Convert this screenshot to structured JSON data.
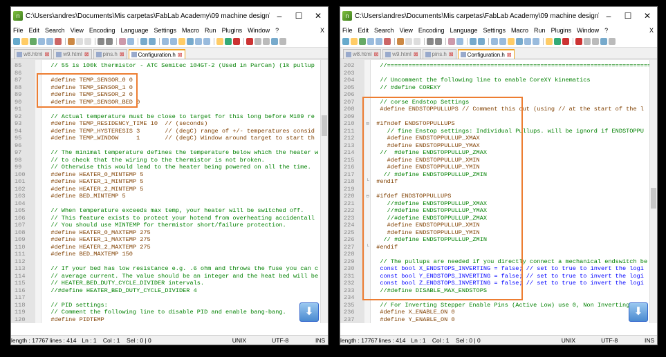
{
  "left": {
    "title": "C:\\Users\\andres\\Documents\\Mis carpetas\\FabLab Academy\\09 machine design\\bib\\Falla3D-m...",
    "menu": [
      "File",
      "Edit",
      "Search",
      "View",
      "Encoding",
      "Language",
      "Settings",
      "Macro",
      "Run",
      "Plugins",
      "Window",
      "?"
    ],
    "menu_close": "X",
    "tabs": [
      {
        "label": "w8.html",
        "active": false
      },
      {
        "label": "w9.html",
        "active": false
      },
      {
        "label": "pins.h",
        "active": false
      },
      {
        "label": "Configuration.h",
        "active": true
      }
    ],
    "lines": [
      {
        "n": "85",
        "t": "  // 55 is 100k thermistor - ATC Semitec 104GT-2 (Used in ParCan) (1k pullup",
        "s": "cm",
        "f": ""
      },
      {
        "n": "86",
        "t": "",
        "s": "",
        "f": ""
      },
      {
        "n": "87",
        "t": "  #define TEMP_SENSOR_0 0",
        "s": "pre",
        "f": ""
      },
      {
        "n": "88",
        "t": "  #define TEMP_SENSOR_1 0",
        "s": "pre",
        "f": ""
      },
      {
        "n": "89",
        "t": "  #define TEMP_SENSOR_2 0",
        "s": "pre",
        "f": ""
      },
      {
        "n": "90",
        "t": "  #define TEMP_SENSOR_BED 0",
        "s": "pre",
        "f": ""
      },
      {
        "n": "91",
        "t": "",
        "s": "",
        "f": ""
      },
      {
        "n": "92",
        "t": "  // Actual temperature must be close to target for this long before M109 re",
        "s": "cm",
        "f": ""
      },
      {
        "n": "93",
        "t": "  #define TEMP_RESIDENCY_TIME 10  // (seconds)",
        "s": "pre",
        "f": ""
      },
      {
        "n": "94",
        "t": "  #define TEMP_HYSTERESIS 3       // (degC) range of +/- temperatures consid",
        "s": "pre",
        "f": ""
      },
      {
        "n": "95",
        "t": "  #define TEMP_WINDOW     1       // (degC) Window around target to start th",
        "s": "pre",
        "f": ""
      },
      {
        "n": "96",
        "t": "",
        "s": "",
        "f": ""
      },
      {
        "n": "97",
        "t": "  // The minimal temperature defines the temperature below which the heater w",
        "s": "cm",
        "f": ""
      },
      {
        "n": "98",
        "t": "  // to check that the wiring to the thermistor is not broken.",
        "s": "cm",
        "f": ""
      },
      {
        "n": "99",
        "t": "  // Otherwise this would lead to the heater being powered on all the time.",
        "s": "cm",
        "f": ""
      },
      {
        "n": "100",
        "t": "  #define HEATER_0_MINTEMP 5",
        "s": "pre",
        "f": ""
      },
      {
        "n": "101",
        "t": "  #define HEATER_1_MINTEMP 5",
        "s": "pre",
        "f": ""
      },
      {
        "n": "102",
        "t": "  #define HEATER_2_MINTEMP 5",
        "s": "pre",
        "f": ""
      },
      {
        "n": "103",
        "t": "  #define BED_MINTEMP 5",
        "s": "pre",
        "f": ""
      },
      {
        "n": "104",
        "t": "",
        "s": "",
        "f": ""
      },
      {
        "n": "105",
        "t": "  // When temperature exceeds max temp, your heater will be switched off.",
        "s": "cm",
        "f": ""
      },
      {
        "n": "106",
        "t": "  // This feature exists to protect your hotend from overheating accidentall",
        "s": "cm",
        "f": ""
      },
      {
        "n": "107",
        "t": "  // You should use MINTEMP for thermistor short/failure protection.",
        "s": "cm",
        "f": ""
      },
      {
        "n": "108",
        "t": "  #define HEATER_0_MAXTEMP 275",
        "s": "pre",
        "f": ""
      },
      {
        "n": "109",
        "t": "  #define HEATER_1_MAXTEMP 275",
        "s": "pre",
        "f": ""
      },
      {
        "n": "110",
        "t": "  #define HEATER_2_MAXTEMP 275",
        "s": "pre",
        "f": ""
      },
      {
        "n": "111",
        "t": "  #define BED_MAXTEMP 150",
        "s": "pre",
        "f": ""
      },
      {
        "n": "112",
        "t": "",
        "s": "",
        "f": ""
      },
      {
        "n": "113",
        "t": "  // If your bed has low resistance e.g. .6 ohm and throws the fuse you can c",
        "s": "cm",
        "f": ""
      },
      {
        "n": "114",
        "t": "  // average current. The value should be an integer and the heat bed will be",
        "s": "cm",
        "f": ""
      },
      {
        "n": "115",
        "t": "  // HEATER_BED_DUTY_CYCLE_DIVIDER intervals.",
        "s": "cm",
        "f": ""
      },
      {
        "n": "116",
        "t": "  //#define HEATER_BED_DUTY_CYCLE_DIVIDER 4",
        "s": "cm",
        "f": ""
      },
      {
        "n": "117",
        "t": "",
        "s": "",
        "f": ""
      },
      {
        "n": "118",
        "t": "  // PID settings:",
        "s": "cm",
        "f": ""
      },
      {
        "n": "119",
        "t": "  // Comment the following line to disable PID and enable bang-bang.",
        "s": "cm",
        "f": ""
      },
      {
        "n": "120",
        "t": "  #define PIDTEMP",
        "s": "pre",
        "f": ""
      }
    ],
    "status": [
      "length : 17767",
      "lines : 414",
      "Ln : 1",
      "Col : 1",
      "Sel : 0 | 0",
      "UNIX",
      "UTF-8",
      "INS"
    ]
  },
  "right": {
    "title": "C:\\Users\\andres\\Documents\\Mis carpetas\\FabLab Academy\\09 machine design\\bib\\Falla3D-m...",
    "menu": [
      "File",
      "Edit",
      "Search",
      "View",
      "Encoding",
      "Language",
      "Settings",
      "Macro",
      "Run",
      "Plugins",
      "Window",
      "?"
    ],
    "menu_close": "X",
    "tabs": [
      {
        "label": "w8.html",
        "active": false
      },
      {
        "label": "w9.html",
        "active": false
      },
      {
        "label": "pins.h",
        "active": false
      },
      {
        "label": "Configuration.h",
        "active": true
      }
    ],
    "lines": [
      {
        "n": "202",
        "t": "  //===========================================================================",
        "s": "cm",
        "f": ""
      },
      {
        "n": "203",
        "t": "",
        "s": "",
        "f": ""
      },
      {
        "n": "204",
        "t": "  // Uncomment the following line to enable CoreXY kinematics",
        "s": "cm",
        "f": ""
      },
      {
        "n": "205",
        "t": "  // #define COREXY",
        "s": "cm",
        "f": ""
      },
      {
        "n": "206",
        "t": "",
        "s": "",
        "f": ""
      },
      {
        "n": "207",
        "t": "  // corse Endstop Settings",
        "s": "cm",
        "f": ""
      },
      {
        "n": "208",
        "t": "  #define ENDSTOPPULLUPS // Comment this out (using // at the start of the l",
        "s": "pre",
        "f": ""
      },
      {
        "n": "209",
        "t": "",
        "s": "",
        "f": ""
      },
      {
        "n": "210",
        "t": " #ifndef ENDSTOPPULLUPS",
        "s": "pre",
        "f": "⊟"
      },
      {
        "n": "211",
        "t": "    // fine Enstop settings: Individual Pullups. will be ignord if ENDSTOPPU",
        "s": "cm",
        "f": ""
      },
      {
        "n": "212",
        "t": "    #define ENDSTOPPULLUP_XMAX",
        "s": "pre",
        "f": ""
      },
      {
        "n": "213",
        "t": "    #define ENDSTOPPULLUP_YMAX",
        "s": "pre",
        "f": ""
      },
      {
        "n": "214",
        "t": "  //  #define ENDSTOPPULLUP_ZMAX",
        "s": "cm",
        "f": ""
      },
      {
        "n": "215",
        "t": "    #define ENDSTOPPULLUP_XMIN",
        "s": "pre",
        "f": ""
      },
      {
        "n": "216",
        "t": "    #define ENDSTOPPULLUP_YMIN",
        "s": "pre",
        "f": ""
      },
      {
        "n": "217",
        "t": "   // #define ENDSTOPPULLUP_ZMIN",
        "s": "cm",
        "f": ""
      },
      {
        "n": "218",
        "t": " #endif",
        "s": "pre",
        "f": "└"
      },
      {
        "n": "219",
        "t": "",
        "s": "",
        "f": ""
      },
      {
        "n": "220",
        "t": " #ifdef ENDSTOPPULLUPS",
        "s": "pre",
        "f": "⊟"
      },
      {
        "n": "221",
        "t": "    //#define ENDSTOPPULLUP_XMAX",
        "s": "cm",
        "f": ""
      },
      {
        "n": "222",
        "t": "    //#define ENDSTOPPULLUP_YMAX",
        "s": "cm",
        "f": ""
      },
      {
        "n": "223",
        "t": "    //#define ENDSTOPPULLUP_ZMAX",
        "s": "cm",
        "f": ""
      },
      {
        "n": "224",
        "t": "    #define ENDSTOPPULLUP_XMIN",
        "s": "pre",
        "f": ""
      },
      {
        "n": "225",
        "t": "    #define ENDSTOPPULLUP_YMIN",
        "s": "pre",
        "f": ""
      },
      {
        "n": "226",
        "t": "   // #define ENDSTOPPULLUP_ZMIN",
        "s": "cm",
        "f": ""
      },
      {
        "n": "227",
        "t": " #endif",
        "s": "pre",
        "f": "└"
      },
      {
        "n": "228",
        "t": "",
        "s": "",
        "f": ""
      },
      {
        "n": "229",
        "t": "  // The pullups are needed if you directly connect a mechanical endswitch be",
        "s": "cm",
        "f": ""
      },
      {
        "n": "230",
        "t": "  const bool X_ENDSTOPS_INVERTING = false; // set to true to invert the logi",
        "s": "kw",
        "f": ""
      },
      {
        "n": "231",
        "t": "  const bool Y_ENDSTOPS_INVERTING = false; // set to true to invert the logi",
        "s": "kw",
        "f": ""
      },
      {
        "n": "232",
        "t": "  const bool Z_ENDSTOPS_INVERTING = false; // set to true to invert the logi",
        "s": "kw",
        "f": ""
      },
      {
        "n": "233",
        "t": "  //#define DISABLE_MAX_ENDSTOPS",
        "s": "cm",
        "f": ""
      },
      {
        "n": "234",
        "t": "",
        "s": "",
        "f": ""
      },
      {
        "n": "235",
        "t": "  // For Inverting Stepper Enable Pins (Active Low) use 0, Non Inverting (Ac",
        "s": "cm",
        "f": ""
      },
      {
        "n": "236",
        "t": "  #define X_ENABLE_ON 0",
        "s": "pre",
        "f": ""
      },
      {
        "n": "237",
        "t": "  #define Y_ENABLE_ON 0",
        "s": "pre",
        "f": ""
      }
    ],
    "status": [
      "length : 17767",
      "lines : 414",
      "Ln : 1",
      "Col : 1",
      "Sel : 0 | 0",
      "UNIX",
      "UTF-8",
      "INS"
    ]
  },
  "window_controls": [
    "–",
    "☐",
    "✕"
  ],
  "accent": "#ed7d31"
}
